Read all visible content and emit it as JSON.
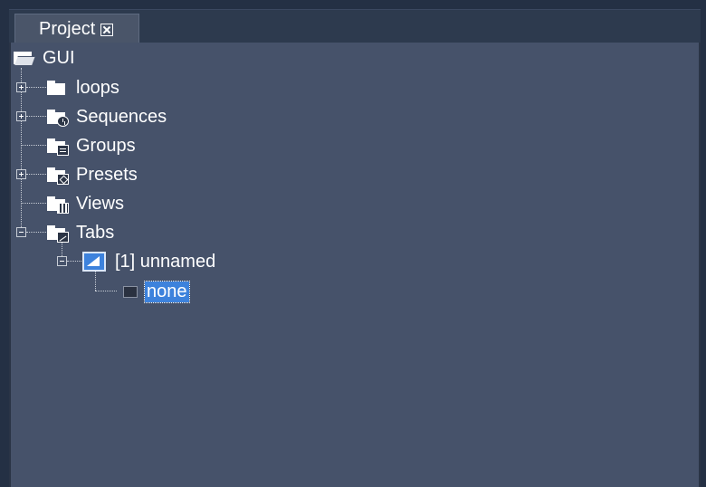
{
  "panel": {
    "tab_label": "Project"
  },
  "tree": {
    "root": {
      "label": "GUI",
      "icon": "open-folder-icon"
    },
    "items": [
      {
        "label": "loops",
        "icon": "folder-icon",
        "expander": "plus"
      },
      {
        "label": "Sequences",
        "icon": "sequence-folder-icon",
        "expander": "plus"
      },
      {
        "label": "Groups",
        "icon": "groups-folder-icon",
        "expander": "none"
      },
      {
        "label": "Presets",
        "icon": "presets-folder-icon",
        "expander": "plus"
      },
      {
        "label": "Views",
        "icon": "views-folder-icon",
        "expander": "none"
      },
      {
        "label": "Tabs",
        "icon": "tabs-folder-icon",
        "expander": "minus"
      }
    ],
    "tab_child": {
      "label": "[1] unnamed",
      "icon": "tab-icon",
      "expander": "minus"
    },
    "leaf": {
      "label": "none",
      "icon": "none-icon",
      "selected": true
    }
  },
  "colors": {
    "background": "#46526a",
    "selection": "#3d82dc",
    "tab_bar": "#2d3a4e"
  }
}
